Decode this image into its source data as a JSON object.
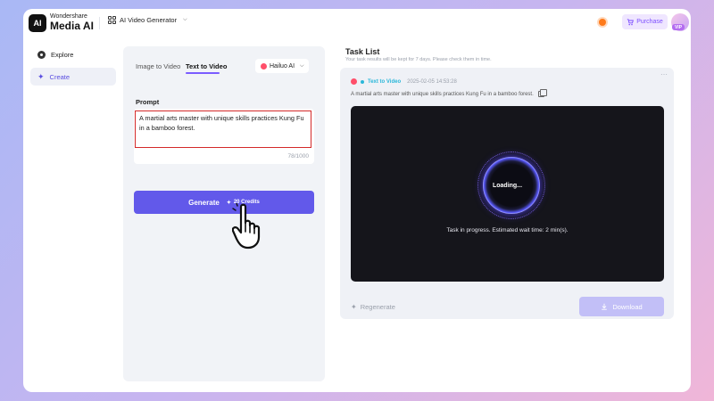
{
  "header": {
    "brand_top": "Wondershare",
    "brand_main": "Media AI",
    "logo_text": "AI",
    "generator_label": "AI Video Generator",
    "purchase_label": "Purchase",
    "vip_label": "VIP"
  },
  "sidebar": {
    "items": [
      {
        "label": "Explore",
        "icon": "compass-icon"
      },
      {
        "label": "Create",
        "icon": "sparkle-icon"
      }
    ]
  },
  "left_panel": {
    "tabs": [
      {
        "label": "Image to Video"
      },
      {
        "label": "Text to Video"
      }
    ],
    "model_label": "Hailuo AI",
    "prompt_label": "Prompt",
    "prompt_text": "A martial arts master with unique skills practices Kung Fu in a bamboo forest.",
    "char_count": "78/1000",
    "generate_label": "Generate",
    "credits_label": "20 Credits"
  },
  "task_list": {
    "title": "Task List",
    "subtitle": "Your task results will be kept for 7 days. Please check them in time.",
    "task": {
      "type": "Text to Video",
      "date": "2025-02-05 14:53:28",
      "prompt": "A martial arts master with unique skills practices Kung Fu in a bamboo forest.",
      "loading_label": "Loading...",
      "progress_text": "Task in progress. Estimated wait time: 2 min(s).",
      "regenerate_label": "Regenerate",
      "download_label": "Download"
    }
  },
  "colors": {
    "accent": "#6259ea",
    "highlight_border": "#d42a2a",
    "task_type": "#2bb7d9",
    "download_disabled": "#c2bff7"
  }
}
